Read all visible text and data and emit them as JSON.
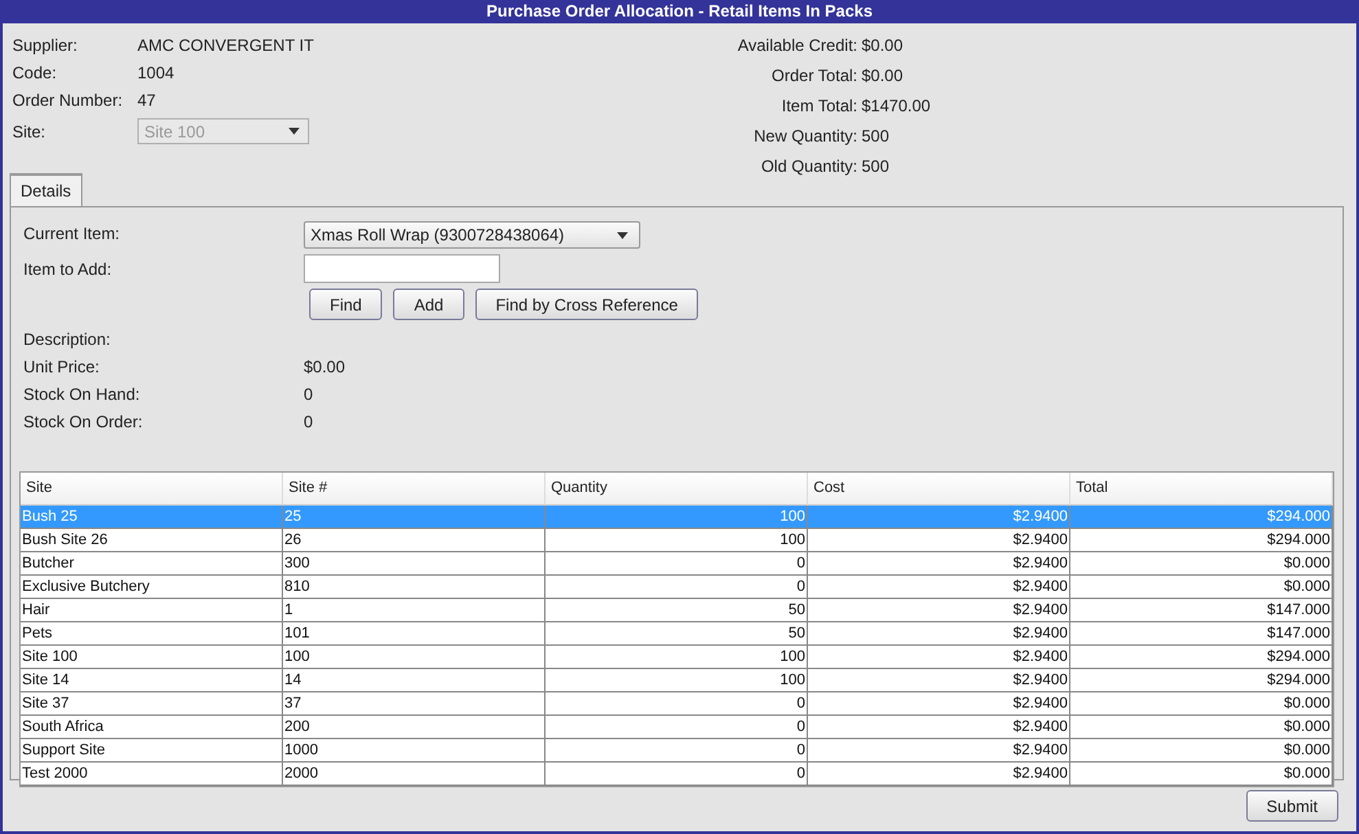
{
  "window": {
    "title": "Purchase Order Allocation  - Retail Items In Packs"
  },
  "header_left": [
    {
      "label": "Supplier:",
      "value": "AMC CONVERGENT IT",
      "kind": "text"
    },
    {
      "label": "Code:",
      "value": "1004",
      "kind": "text"
    },
    {
      "label": "Order Number:",
      "value": "47",
      "kind": "text"
    },
    {
      "label": "Site:",
      "value": "Site 100",
      "kind": "dropdown",
      "disabled": true
    }
  ],
  "header_right": [
    {
      "label": "Available Credit:",
      "value": "$0.00"
    },
    {
      "label": "Order Total:",
      "value": "$0.00"
    },
    {
      "label": "Item Total:",
      "value": "$1470.00"
    },
    {
      "label": "New Quantity:",
      "value": "500"
    },
    {
      "label": "Old Quantity:",
      "value": "500"
    }
  ],
  "tabs": [
    {
      "label": "Details",
      "selected": true
    }
  ],
  "current_item": {
    "label": "Current Item:",
    "value": "Xmas Roll Wrap (9300728438064)"
  },
  "item_to_add": {
    "label": "Item to Add:"
  },
  "buttons": [
    "Find",
    "Add",
    "Find by Cross Reference"
  ],
  "details": [
    {
      "label": "Description:"
    },
    {
      "label": "Unit Price:",
      "value": "$0.00"
    },
    {
      "label": "Stock On Hand:",
      "value": "0"
    },
    {
      "label": "Stock On Order:",
      "value": "0"
    }
  ],
  "table": {
    "columns": [
      "Site",
      "Site #",
      "Quantity",
      "Cost",
      "Total"
    ],
    "rows": [
      {
        "cells": [
          "Bush 25",
          "25",
          "100",
          "$2.9400",
          "$294.000"
        ],
        "selected": true
      },
      {
        "cells": [
          "Bush Site 26",
          "26",
          "100",
          "$2.9400",
          "$294.000"
        ],
        "selected": false
      },
      {
        "cells": [
          "Butcher",
          "300",
          "0",
          "$2.9400",
          "$0.000"
        ],
        "selected": false
      },
      {
        "cells": [
          "Exclusive Butchery",
          "810",
          "0",
          "$2.9400",
          "$0.000"
        ],
        "selected": false
      },
      {
        "cells": [
          "Hair",
          "1",
          "50",
          "$2.9400",
          "$147.000"
        ],
        "selected": false
      },
      {
        "cells": [
          "Pets",
          "101",
          "50",
          "$2.9400",
          "$147.000"
        ],
        "selected": false
      },
      {
        "cells": [
          "Site 100",
          "100",
          "100",
          "$2.9400",
          "$294.000"
        ],
        "selected": false
      },
      {
        "cells": [
          "Site 14",
          "14",
          "100",
          "$2.9400",
          "$294.000"
        ],
        "selected": false
      },
      {
        "cells": [
          "Site 37",
          "37",
          "0",
          "$2.9400",
          "$0.000"
        ],
        "selected": false
      },
      {
        "cells": [
          "South Africa",
          "200",
          "0",
          "$2.9400",
          "$0.000"
        ],
        "selected": false
      },
      {
        "cells": [
          "Support Site",
          "1000",
          "0",
          "$2.9400",
          "$0.000"
        ],
        "selected": false
      },
      {
        "cells": [
          "Test 2000",
          "2000",
          "0",
          "$2.9400",
          "$0.000"
        ],
        "selected": false
      }
    ]
  },
  "submit": "Submit"
}
